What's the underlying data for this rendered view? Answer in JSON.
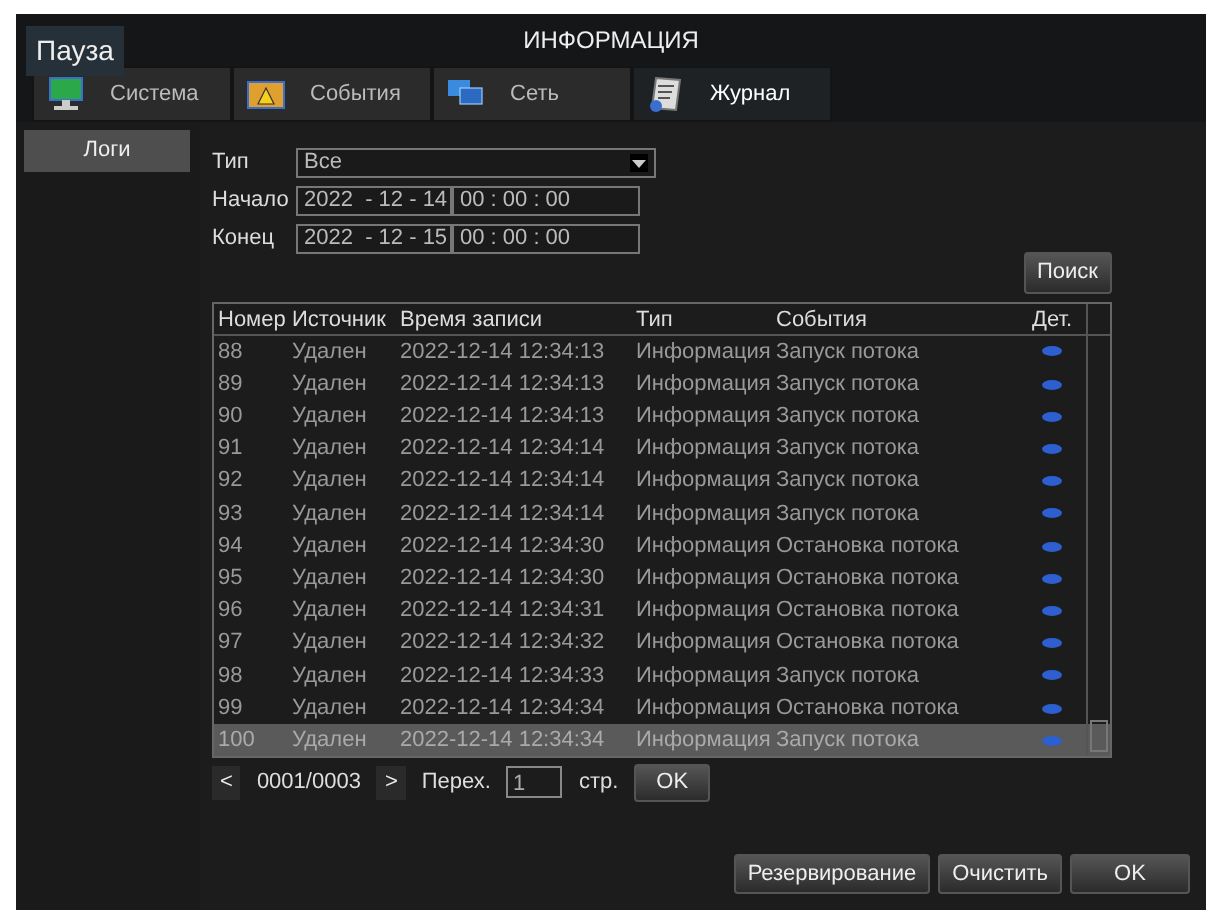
{
  "window": {
    "title": "ИНФОРМАЦИЯ",
    "pause_label": "Пауза"
  },
  "tabs": [
    {
      "label": "Система",
      "kind": "system",
      "selected": false
    },
    {
      "label": "События",
      "kind": "events",
      "selected": false
    },
    {
      "label": "Сеть",
      "kind": "network",
      "selected": false
    },
    {
      "label": "Журнал",
      "kind": "journal",
      "selected": true
    }
  ],
  "sidebar": {
    "items": [
      {
        "label": "Логи",
        "selected": true
      }
    ]
  },
  "filters": {
    "type_label": "Тип",
    "type_value": "Все",
    "start_label": "Начало",
    "start_date": "2022  - 12 - 14",
    "start_time": "00 : 00 : 00",
    "end_label": "Конец",
    "end_date": "2022  - 12 - 15",
    "end_time": "00 : 00 : 00",
    "search_button": "Поиск"
  },
  "table": {
    "columns": [
      "Номер",
      "Источник",
      "Время записи",
      "Тип",
      "События",
      "Дет."
    ],
    "rows": [
      {
        "cells": [
          "88",
          "Удален",
          "2022-12-14 12:34:13",
          "Информация",
          "Запуск потока"
        ],
        "selected": false
      },
      {
        "cells": [
          "89",
          "Удален",
          "2022-12-14 12:34:13",
          "Информация",
          "Запуск потока"
        ],
        "selected": false
      },
      {
        "cells": [
          "90",
          "Удален",
          "2022-12-14 12:34:13",
          "Информация",
          "Запуск потока"
        ],
        "selected": false
      },
      {
        "cells": [
          "91",
          "Удален",
          "2022-12-14 12:34:14",
          "Информация",
          "Запуск потока"
        ],
        "selected": false
      },
      {
        "cells": [
          "92",
          "Удален",
          "2022-12-14 12:34:14",
          "Информация",
          "Запуск потока"
        ],
        "selected": false
      },
      {
        "cells": [
          "93",
          "Удален",
          "2022-12-14 12:34:14",
          "Информация",
          "Запуск потока"
        ],
        "selected": false
      },
      {
        "cells": [
          "94",
          "Удален",
          "2022-12-14 12:34:30",
          "Информация",
          "Остановка потока"
        ],
        "selected": false
      },
      {
        "cells": [
          "95",
          "Удален",
          "2022-12-14 12:34:30",
          "Информация",
          "Остановка потока"
        ],
        "selected": false
      },
      {
        "cells": [
          "96",
          "Удален",
          "2022-12-14 12:34:31",
          "Информация",
          "Остановка потока"
        ],
        "selected": false
      },
      {
        "cells": [
          "97",
          "Удален",
          "2022-12-14 12:34:32",
          "Информация",
          "Остановка потока"
        ],
        "selected": false
      },
      {
        "cells": [
          "98",
          "Удален",
          "2022-12-14 12:34:33",
          "Информация",
          "Запуск потока"
        ],
        "selected": false
      },
      {
        "cells": [
          "99",
          "Удален",
          "2022-12-14 12:34:34",
          "Информация",
          "Остановка потока"
        ],
        "selected": false
      },
      {
        "cells": [
          "100",
          "Удален",
          "2022-12-14 12:34:34",
          "Информация",
          "Запуск потока"
        ],
        "selected": true
      }
    ]
  },
  "pager": {
    "prev": "<",
    "page": "0001/0003",
    "next": ">",
    "goto_label": "Перех.",
    "goto_value": "1",
    "page_unit": "стр.",
    "go_button": "OK"
  },
  "buttons": [
    "Резервирование",
    "Очистить",
    "OK"
  ]
}
